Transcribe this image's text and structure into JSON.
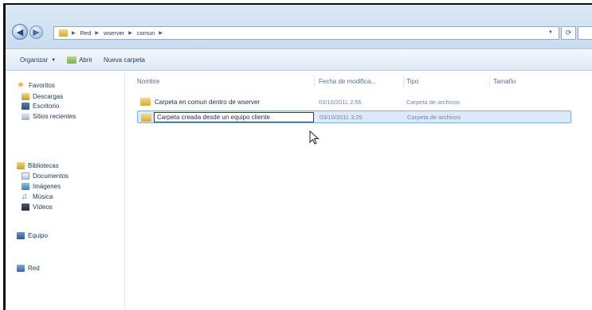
{
  "address_bar": {
    "breadcrumbs": [
      "Red",
      "wserver",
      "comun"
    ]
  },
  "toolbar": {
    "organize_label": "Organizar",
    "open_label": "Abrir",
    "new_folder_label": "Nueva carpeta"
  },
  "sidebar": {
    "favorites_label": "Favoritos",
    "favorites_items": [
      "Descargas",
      "Escritorio",
      "Sitios recientes"
    ],
    "libraries_label": "Bibliotecas",
    "libraries_items": [
      "Documentos",
      "Imágenes",
      "Música",
      "Vídeos"
    ],
    "computer_label": "Equipo",
    "network_label": "Red"
  },
  "columns": {
    "name": "Nombre",
    "date": "Fecha de modifica...",
    "type": "Tipo",
    "size": "Tamaño"
  },
  "files": [
    {
      "name": "Carpeta en comun dentro de wserver",
      "date": "03/10/2011 2:56",
      "type": "Carpeta de archivos"
    },
    {
      "name": "Carpeta creada desde un equipo cliente",
      "date": "03/10/2011 3:25",
      "type": "Carpeta de archivos"
    }
  ]
}
